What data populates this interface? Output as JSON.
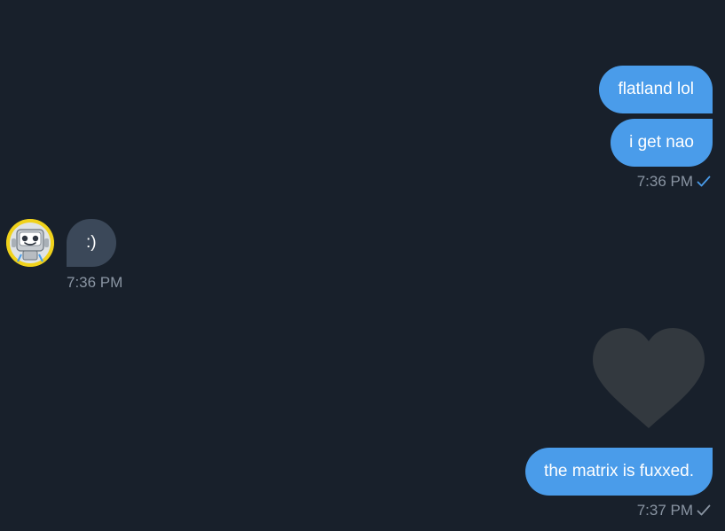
{
  "messages": [
    {
      "text": "flatland lol"
    },
    {
      "text": "i get nao"
    },
    {
      "text": ":)"
    },
    {
      "text": "the matrix is fuxxed."
    }
  ],
  "times": {
    "group1": "7:36 PM",
    "group2": "7:36 PM",
    "group3": "7:37 PM"
  },
  "icons": {
    "read_check": "check-icon",
    "sent_check": "check-icon",
    "reaction": "heart-icon",
    "avatar": "robot-avatar"
  },
  "colors": {
    "background": "#18202b",
    "outgoing_bubble": "#4a9cea",
    "incoming_bubble": "#3b4859",
    "read_check": "#4a9cea",
    "sent_check": "#8a95a3",
    "heart": "#33393f",
    "avatar_ring": "#f0d21b"
  }
}
